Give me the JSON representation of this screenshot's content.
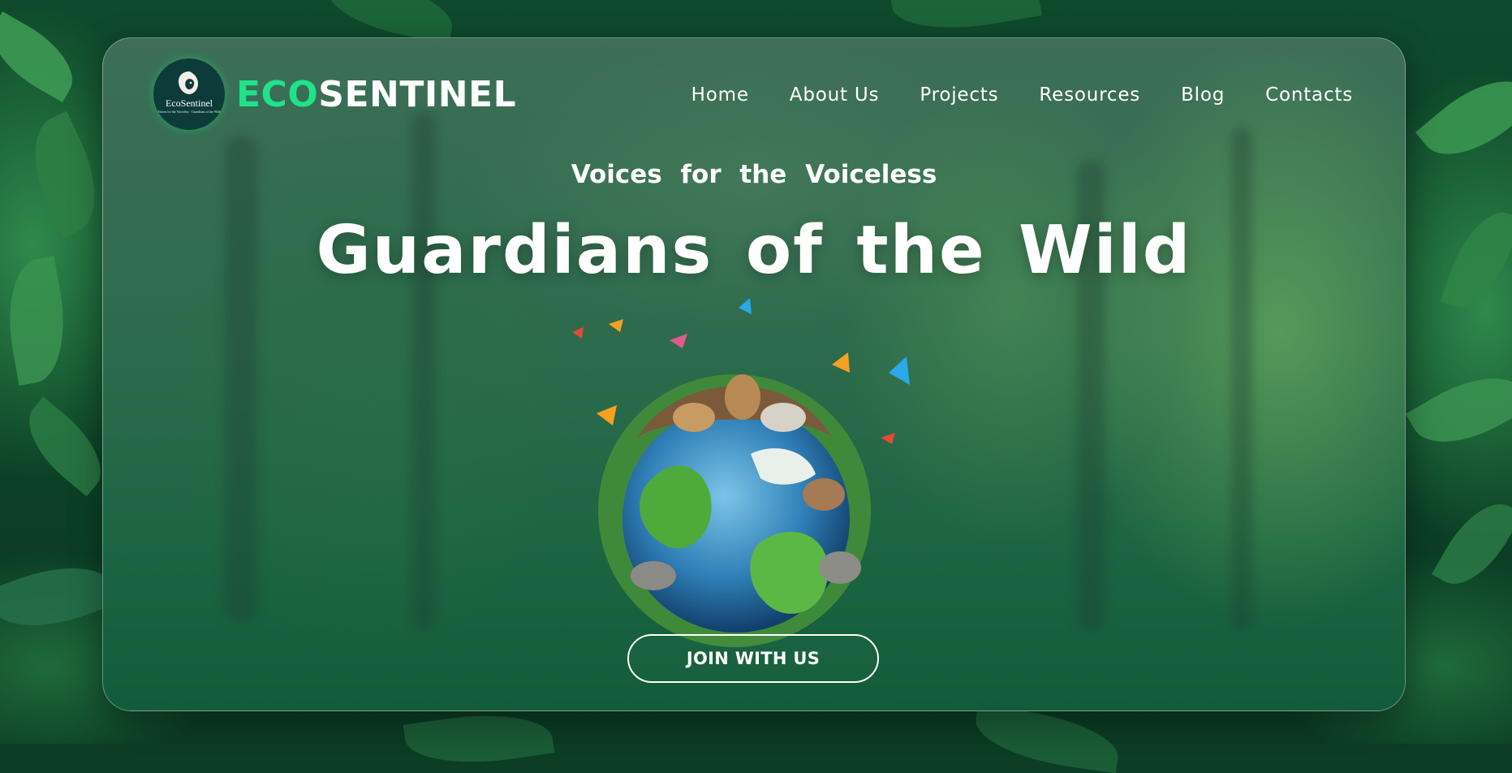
{
  "brand": {
    "logo_name": "EcoSentinel",
    "logo_tagline": "Voices for the Voiceless · Guardians of the Wild",
    "name_accent": "ECO",
    "name_rest": "SENTINEL"
  },
  "nav": {
    "items": [
      {
        "label": "Home"
      },
      {
        "label": "About Us"
      },
      {
        "label": "Projects"
      },
      {
        "label": "Resources"
      },
      {
        "label": "Blog"
      },
      {
        "label": "Contacts"
      }
    ]
  },
  "hero": {
    "tagline": "Voices for the Voiceless",
    "headline": "Guardians of the Wild",
    "cta_label": "JOIN WITH US",
    "image_icon": "earth-with-wildlife-illustration"
  },
  "colors": {
    "accent": "#1fe38a",
    "card_bg": "#2d6b4c",
    "backdrop": "#0c3d25"
  }
}
